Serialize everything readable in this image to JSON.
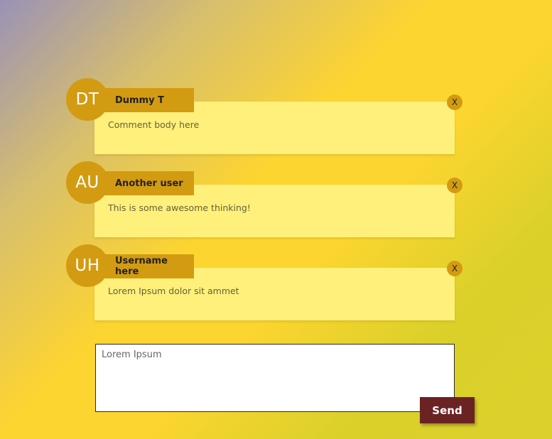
{
  "comments": [
    {
      "initials": "DT",
      "name": "Dummy T",
      "body": "Comment body here",
      "close_label": "X"
    },
    {
      "initials": "AU",
      "name": "Another user",
      "body": "This is some awesome thinking!",
      "close_label": "X"
    },
    {
      "initials": "UH",
      "name": "Username here",
      "body": "Lorem Ipsum dolor sit ammet",
      "close_label": "X"
    }
  ],
  "reply": {
    "value": "Lorem Ipsum",
    "send_label": "Send"
  },
  "colors": {
    "accent": "#d39b12",
    "card": "#fef07a",
    "send_button": "#6b2222",
    "background_start": "#9a92b6",
    "background_mid": "#fdd530",
    "background_end": "#dcd02c"
  },
  "icons": {
    "close": "x-icon"
  }
}
